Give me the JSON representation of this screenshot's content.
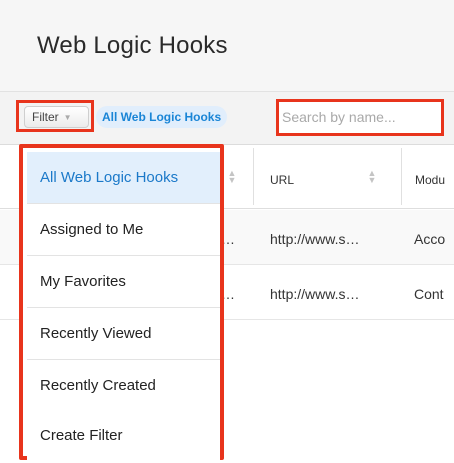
{
  "header": {
    "title": "Web Logic Hooks"
  },
  "filterbar": {
    "filter_label": "Filter",
    "active_filter": "All Web Logic Hooks",
    "search_placeholder": "Search by name..."
  },
  "table": {
    "columns": [
      "URL",
      "Modu"
    ],
    "rows": [
      {
        "name_trunc": "…",
        "url": "http://www.s…",
        "module": "Acco"
      },
      {
        "name_trunc": "…",
        "url": "http://www.s…",
        "module": "Cont"
      }
    ]
  },
  "dropdown": {
    "items": [
      {
        "label": "All Web Logic Hooks",
        "selected": true
      },
      {
        "label": "Assigned to Me",
        "selected": false
      },
      {
        "label": "My Favorites",
        "selected": false
      },
      {
        "label": "Recently Viewed",
        "selected": false
      },
      {
        "label": "Recently Created",
        "selected": false
      },
      {
        "label": "Create Filter",
        "selected": false
      }
    ]
  },
  "colors": {
    "highlight": "#e8341c",
    "link_blue": "#1a85d6",
    "selected_bg": "#e2effc"
  },
  "icons": {
    "filter_caret": "caret-down-icon",
    "sort": "sort-icon"
  }
}
